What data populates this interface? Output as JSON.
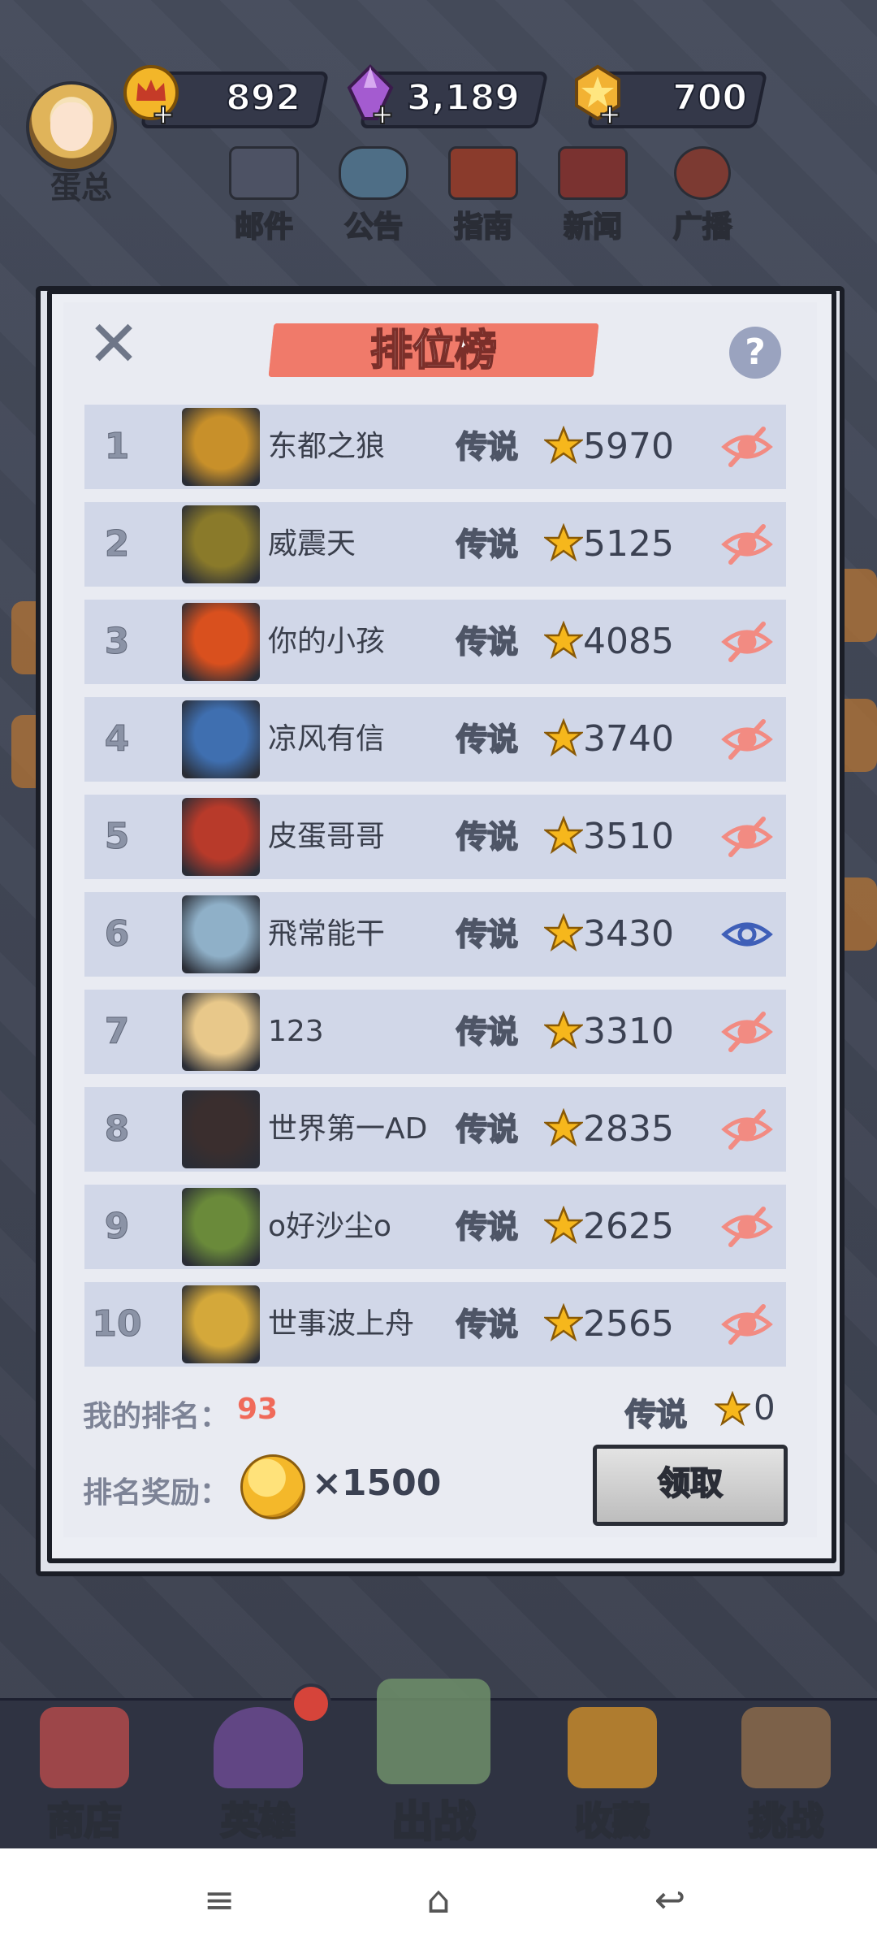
{
  "player": {
    "name": "蛋总"
  },
  "resources": [
    {
      "name": "gold",
      "value": "892",
      "icon": "crown-coin-icon"
    },
    {
      "name": "gems",
      "value": "3,189",
      "icon": "purple-gem-icon"
    },
    {
      "name": "stars",
      "value": "700",
      "icon": "star-badge-icon"
    }
  ],
  "top_menu": [
    {
      "label": "邮件",
      "icon": "mail-icon"
    },
    {
      "label": "公告",
      "icon": "scroll-icon"
    },
    {
      "label": "指南",
      "icon": "book-icon"
    },
    {
      "label": "新闻",
      "icon": "news-tv-icon"
    },
    {
      "label": "广播",
      "icon": "no-broadcast-icon"
    }
  ],
  "leaderboard": {
    "title": "排位榜",
    "help_symbol": "?",
    "close_symbol": "✕",
    "rows": [
      {
        "rank": "1",
        "name": "东都之狼",
        "tier": "传说",
        "score": "5970",
        "visible": false
      },
      {
        "rank": "2",
        "name": "威震天",
        "tier": "传说",
        "score": "5125",
        "visible": false
      },
      {
        "rank": "3",
        "name": "你的小孩",
        "tier": "传说",
        "score": "4085",
        "visible": false
      },
      {
        "rank": "4",
        "name": "凉风有信",
        "tier": "传说",
        "score": "3740",
        "visible": false
      },
      {
        "rank": "5",
        "name": "皮蛋哥哥",
        "tier": "传说",
        "score": "3510",
        "visible": false
      },
      {
        "rank": "6",
        "name": "飛常能干",
        "tier": "传说",
        "score": "3430",
        "visible": true
      },
      {
        "rank": "7",
        "name": "123",
        "tier": "传说",
        "score": "3310",
        "visible": false
      },
      {
        "rank": "8",
        "name": "世界第一AD",
        "tier": "传说",
        "score": "2835",
        "visible": false
      },
      {
        "rank": "9",
        "name": "o好沙尘o",
        "tier": "传说",
        "score": "2625",
        "visible": false
      },
      {
        "rank": "10",
        "name": "世事波上舟",
        "tier": "传说",
        "score": "2565",
        "visible": false
      }
    ],
    "my_rank_label": "我的排名：",
    "my_rank_value": "93",
    "my_tier": "传说",
    "my_score": "0",
    "reward_label": "排名奖励：",
    "reward_amount": "×1500",
    "claim_label": "领取"
  },
  "bottom_nav": [
    {
      "label": "商店",
      "icon": "shop-icon"
    },
    {
      "label": "英雄",
      "icon": "hero-helmet-icon"
    },
    {
      "label": "出战",
      "icon": "crossed-swords-icon"
    },
    {
      "label": "收藏",
      "icon": "treasure-chest-icon"
    },
    {
      "label": "挑战",
      "icon": "bow-icon"
    }
  ],
  "system_bar": {
    "menu": "≡",
    "home": "⌂",
    "back": "↩"
  },
  "colors": {
    "accent_ribbon": "#f07a6a",
    "row_bg": "#d1d7e8",
    "rank_value": "#f06a5a",
    "eye_hidden": "#f28b82",
    "eye_visible": "#3f5fb8"
  }
}
